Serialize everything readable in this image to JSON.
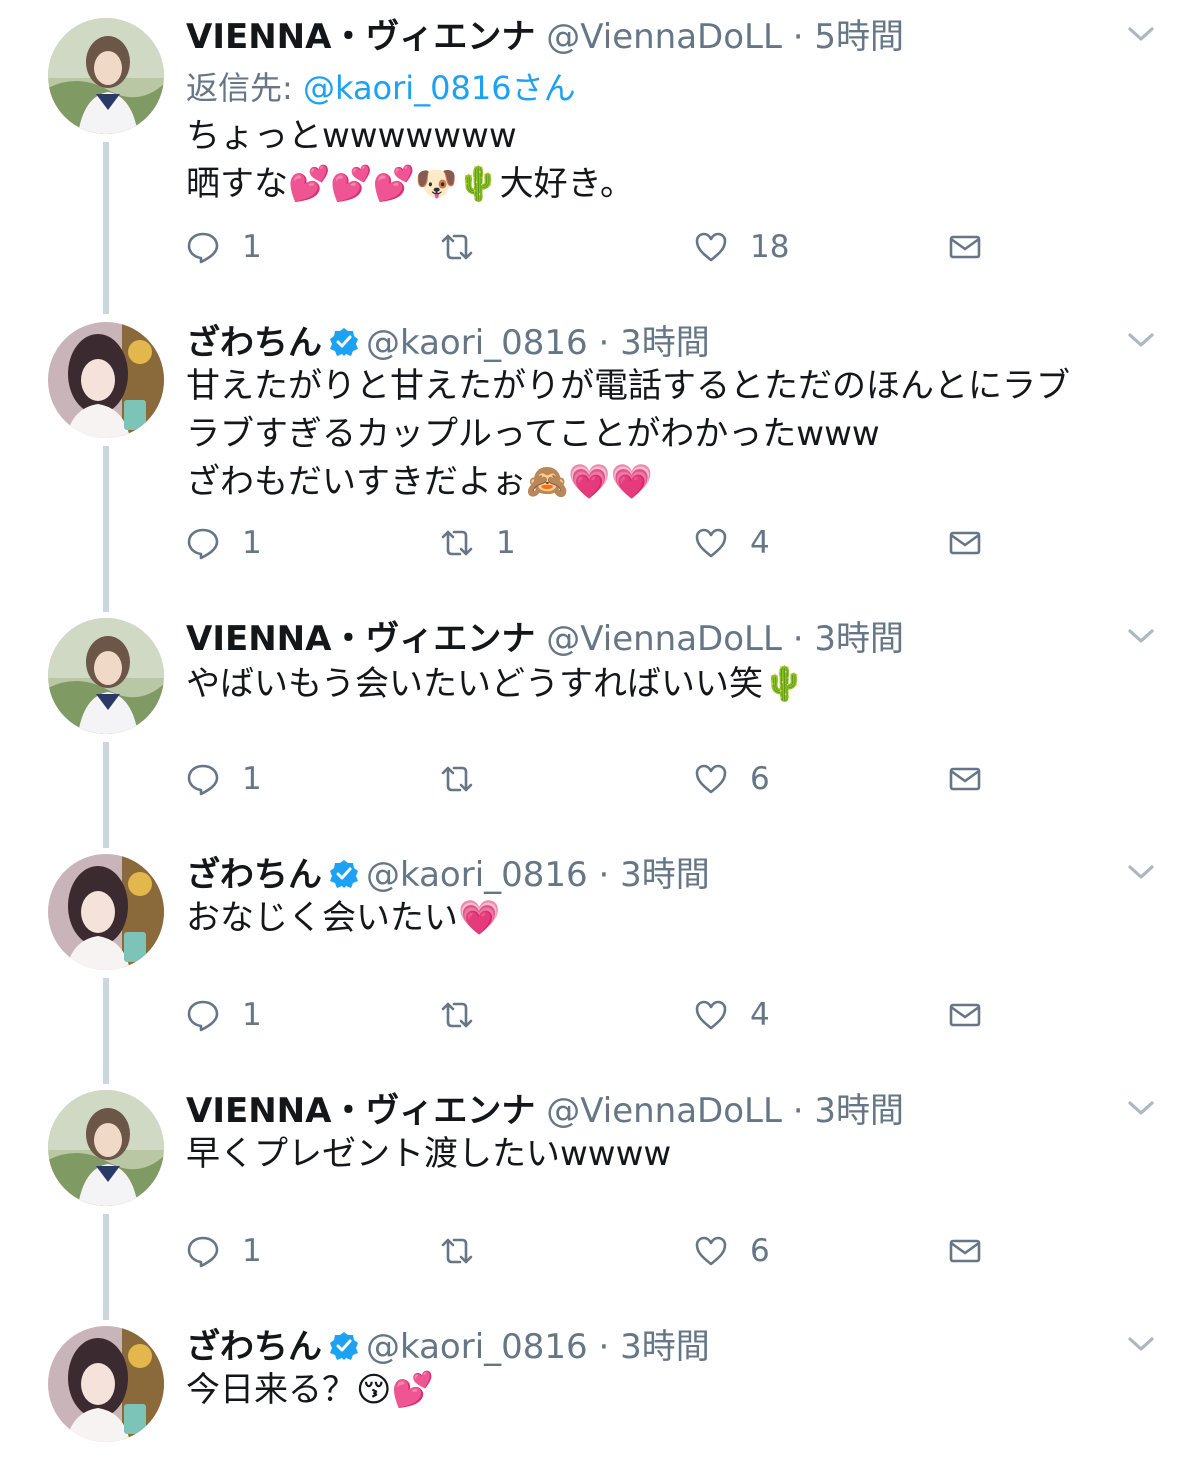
{
  "tweets": [
    {
      "name": "VIENNA・ヴィエンナ",
      "handle": "@ViennaDoLL",
      "dot": "·",
      "time": "5時間",
      "reply_label": "返信先: ",
      "reply_mention": "@kaori_0816さん",
      "lines": [
        "ちょっとwwwwwww",
        "晒すな💕💕💕🐶🌵大好き。"
      ],
      "replies": "1",
      "retweets": "",
      "likes": "18"
    },
    {
      "name": "ざわちん",
      "verified": true,
      "handle": "@kaori_0816",
      "dot": "·",
      "time": "3時間",
      "lines": [
        "甘えたがりと甘えたがりが電話するとただのほんとにラブ",
        "ラブすぎるカップルってことがわかったwww",
        "ざわもだいすきだよぉ🙈💗💗"
      ],
      "replies": "1",
      "retweets": "1",
      "likes": "4"
    },
    {
      "name": "VIENNA・ヴィエンナ",
      "handle": "@ViennaDoLL",
      "dot": "·",
      "time": "3時間",
      "lines": [
        "やばいもう会いたいどうすればいい笑🌵"
      ],
      "replies": "1",
      "retweets": "",
      "likes": "6"
    },
    {
      "name": "ざわちん",
      "verified": true,
      "handle": "@kaori_0816",
      "dot": "·",
      "time": "3時間",
      "lines": [
        "おなじく会いたい💗"
      ],
      "replies": "1",
      "retweets": "",
      "likes": "4"
    },
    {
      "name": "VIENNA・ヴィエンナ",
      "handle": "@ViennaDoLL",
      "dot": "·",
      "time": "3時間",
      "lines": [
        "早くプレゼント渡したいwwww"
      ],
      "replies": "1",
      "retweets": "",
      "likes": "6"
    },
    {
      "name": "ざわちん",
      "verified": true,
      "handle": "@kaori_0816",
      "dot": "·",
      "time": "3時間",
      "lines": [
        "今日来る？😚💕"
      ]
    }
  ],
  "colors": {
    "accent": "#1da1f2",
    "muted": "#657786",
    "thread": "#ccd6dd"
  },
  "icons": {
    "reply": "reply-icon",
    "retweet": "retweet-icon",
    "like": "heart-icon",
    "dm": "envelope-icon",
    "menu": "chevron-down-icon",
    "verified": "verified-badge-icon"
  }
}
